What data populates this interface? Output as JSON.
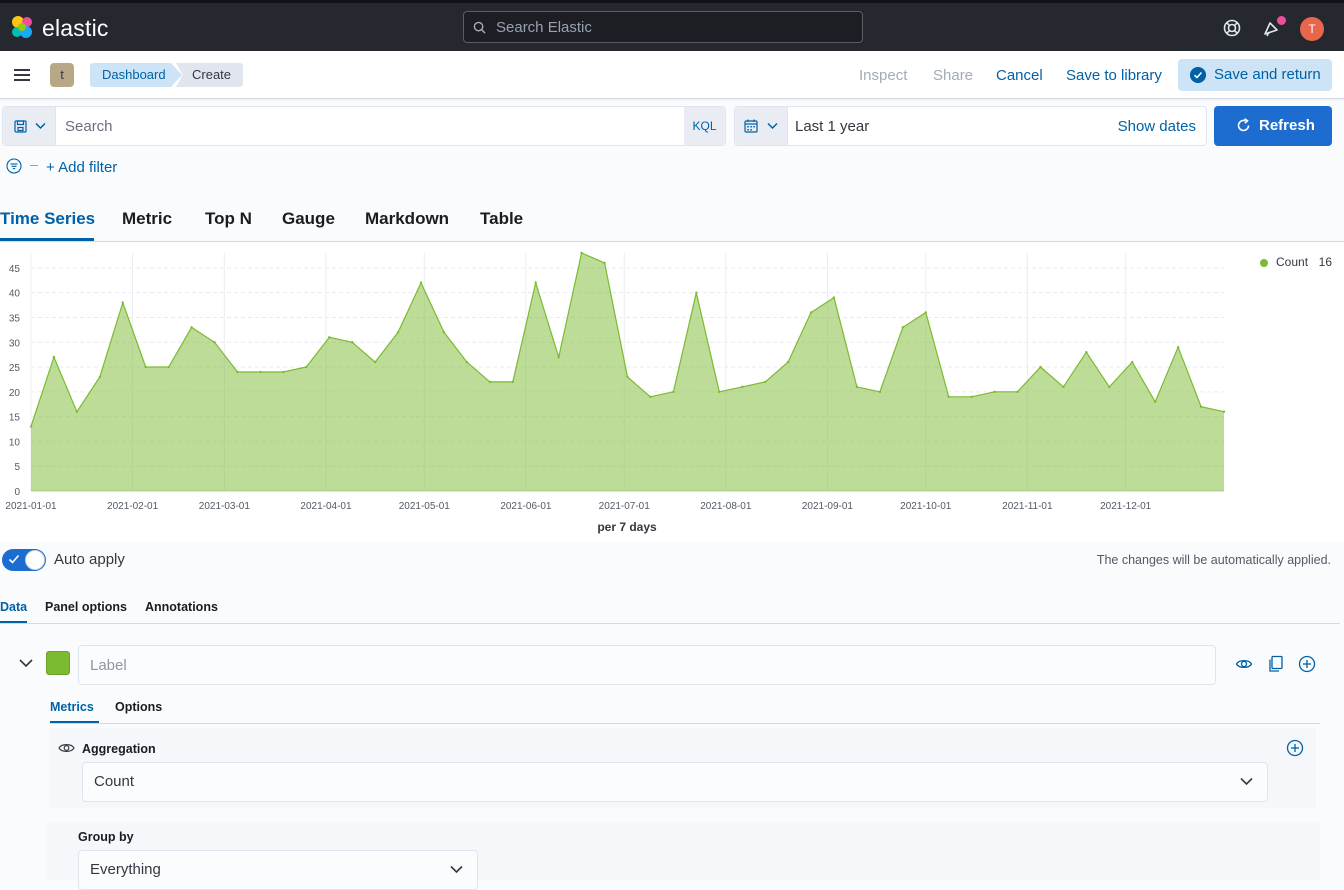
{
  "header": {
    "brand": "elastic",
    "search_placeholder": "Search Elastic",
    "avatar_initial": "T",
    "space_initial": "t"
  },
  "breadcrumbs": [
    "Dashboard",
    "Create"
  ],
  "top_actions": {
    "inspect": "Inspect",
    "share": "Share",
    "cancel": "Cancel",
    "save_to_library": "Save to library",
    "save_and_return": "Save and return"
  },
  "query": {
    "search_placeholder": "Search",
    "language": "KQL",
    "time_range": "Last 1 year",
    "show_dates": "Show dates",
    "refresh": "Refresh",
    "add_filter": "+ Add filter"
  },
  "viz_tabs": [
    "Time Series",
    "Metric",
    "Top N",
    "Gauge",
    "Markdown",
    "Table"
  ],
  "chart_data": {
    "type": "area",
    "x": [
      "2021-01-01",
      "2021-01-08",
      "2021-01-15",
      "2021-01-22",
      "2021-01-29",
      "2021-02-05",
      "2021-02-12",
      "2021-02-19",
      "2021-02-26",
      "2021-03-05",
      "2021-03-12",
      "2021-03-19",
      "2021-03-26",
      "2021-04-02",
      "2021-04-09",
      "2021-04-16",
      "2021-04-23",
      "2021-04-30",
      "2021-05-07",
      "2021-05-14",
      "2021-05-21",
      "2021-05-28",
      "2021-06-04",
      "2021-06-11",
      "2021-06-18",
      "2021-06-25",
      "2021-07-02",
      "2021-07-09",
      "2021-07-16",
      "2021-07-23",
      "2021-07-30",
      "2021-08-06",
      "2021-08-13",
      "2021-08-20",
      "2021-08-27",
      "2021-09-03",
      "2021-09-10",
      "2021-09-17",
      "2021-09-24",
      "2021-10-01",
      "2021-10-08",
      "2021-10-15",
      "2021-10-22",
      "2021-10-29",
      "2021-11-05",
      "2021-11-12",
      "2021-11-19",
      "2021-11-26",
      "2021-12-03",
      "2021-12-10",
      "2021-12-17",
      "2021-12-24",
      "2021-12-31"
    ],
    "series": [
      {
        "name": "Count",
        "color": "#7cba31",
        "values": [
          13,
          27,
          16,
          23,
          38,
          25,
          25,
          33,
          30,
          24,
          24,
          24,
          25,
          31,
          30,
          26,
          32,
          42,
          32,
          26,
          22,
          22,
          42,
          27,
          48,
          46,
          23,
          19,
          20,
          40,
          20,
          21,
          22,
          26,
          36,
          39,
          21,
          20,
          33,
          36,
          19,
          19,
          20,
          20,
          25,
          21,
          28,
          21,
          26,
          18,
          29,
          17,
          16
        ]
      }
    ],
    "legend": [
      {
        "label": "Count",
        "value": "16"
      }
    ],
    "x_ticks": [
      "2021-01-01",
      "2021-02-01",
      "2021-03-01",
      "2021-04-01",
      "2021-05-01",
      "2021-06-01",
      "2021-07-01",
      "2021-08-01",
      "2021-09-01",
      "2021-10-01",
      "2021-11-01",
      "2021-12-01"
    ],
    "y_ticks": [
      0,
      5,
      10,
      15,
      20,
      25,
      30,
      35,
      40,
      45
    ],
    "ylim": [
      0,
      48
    ],
    "xlabel": "per 7 days",
    "ylabel": "",
    "grid": true,
    "legend_position": "top-right"
  },
  "auto_apply": {
    "label": "Auto apply",
    "enabled": true,
    "message": "The changes will be automatically applied."
  },
  "editor_tabs": [
    "Data",
    "Panel options",
    "Annotations"
  ],
  "series_editor": {
    "label_placeholder": "Label",
    "color": "#7cba31",
    "sub_tabs": [
      "Metrics",
      "Options"
    ],
    "aggregation_label": "Aggregation",
    "aggregation_value": "Count",
    "group_by_label": "Group by",
    "group_by_value": "Everything"
  }
}
